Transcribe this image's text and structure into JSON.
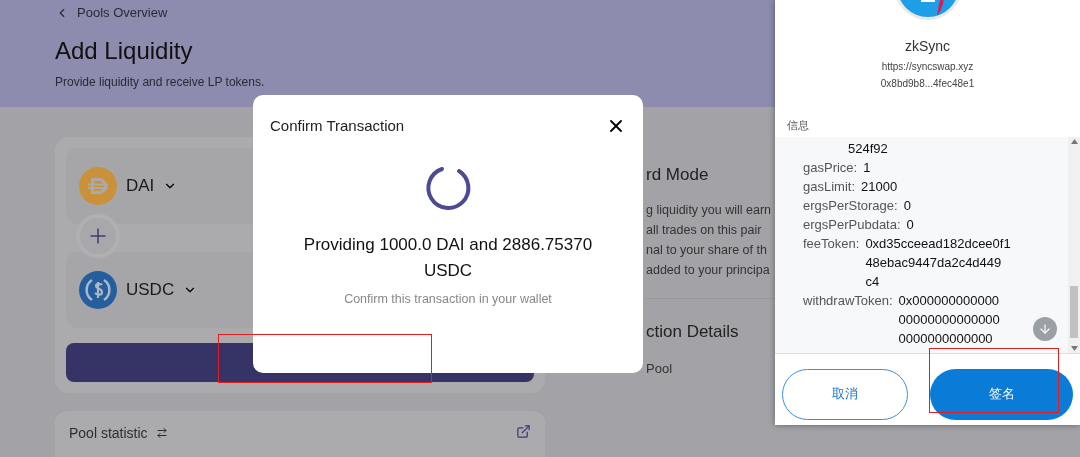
{
  "back_link": "Pools Overview",
  "page": {
    "title": "Add Liquidity",
    "subtitle": "Provide liquidity and receive LP tokens."
  },
  "tokens": [
    {
      "kind": "dai",
      "symbol": "DAI"
    },
    {
      "kind": "usdc",
      "symbol": "USDC"
    }
  ],
  "right_panel": {
    "mode_title": "rd Mode",
    "description_lines": [
      "g liquidity you will earn",
      "all trades on this pair",
      "nal to your share of th",
      "added to your principa"
    ],
    "details_title": "ction Details",
    "details_item": "Pool"
  },
  "pool_statistic": {
    "title": "Pool statistic"
  },
  "modal": {
    "title": "Confirm Transaction",
    "message": "Providing 1000.0 DAI and 2886.75370 USDC",
    "hint": "Confirm this transaction in your wallet"
  },
  "wallet": {
    "network": "zkSync",
    "origin": "https://syncswap.xyz",
    "account": "0x8bd9b8...4fec48e1",
    "section_label": "信息",
    "fields": [
      {
        "kind": "continuation",
        "value_lines": [
          "524f92"
        ]
      },
      {
        "kind": "field",
        "key": "gasPrice:",
        "value_lines": [
          "1"
        ]
      },
      {
        "kind": "field",
        "key": "gasLimit:",
        "value_lines": [
          "21000"
        ]
      },
      {
        "kind": "field",
        "key": "ergsPerStorage:",
        "value_lines": [
          "0"
        ]
      },
      {
        "kind": "field",
        "key": "ergsPerPubdata:",
        "value_lines": [
          "0"
        ]
      },
      {
        "kind": "field",
        "key": "feeToken:",
        "value_lines": [
          "0xd35cceead182dcee0f1",
          "48ebac9447da2c4d449",
          "c4"
        ]
      },
      {
        "kind": "field",
        "key": "withdrawToken:",
        "value_lines": [
          "0x000000000000",
          "00000000000000",
          "0000000000000"
        ]
      }
    ],
    "cancel_label": "取消",
    "sign_label": "签名"
  }
}
